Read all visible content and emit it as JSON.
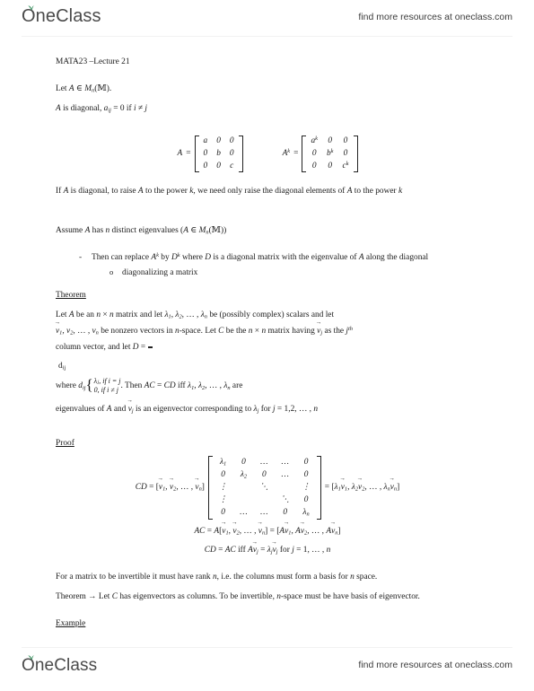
{
  "brand": {
    "name": "OneClass",
    "leaf_color": "#2e8b57",
    "text_color": "#4a4a4a",
    "tagline": "find more resources at oneclass.com"
  },
  "document": {
    "course_title": "MATA23 –Lecture 21",
    "line_let_a": "Let A ∈ Mₙ(ℝ).",
    "line_diagonal": "A is diagonal, aᵢⱼ = 0 if i ≠ j",
    "matrix_a": {
      "label": "A",
      "rows": [
        [
          "a",
          "0",
          "0"
        ],
        [
          "0",
          "b",
          "0"
        ],
        [
          "0",
          "0",
          "c"
        ]
      ]
    },
    "matrix_ak": {
      "label": "Aᵏ",
      "rows": [
        [
          "aᵏ",
          "0",
          "0"
        ],
        [
          "0",
          "bᵏ",
          "0"
        ],
        [
          "0",
          "0",
          "cᵏ"
        ]
      ]
    },
    "para_power": "If A is diagonal, to raise A to the power k, we need only raise the diagonal elements of  A to the power k",
    "assume_line": "Assume A has n distinct eigenvalues (A ∈ Mₙ(ℝ))",
    "bullet_replace": "Then can replace Aᵏ by Dᵏ where D is a diagonal matrix with the eigenvalue of A along the diagonal",
    "bullet_diagonalizing": "diagonalizing a matrix",
    "theorem_heading": "Theorem",
    "theorem_line_1": "Let A be an n × n matrix and let λ₁, λ₂, … , λₙ be (possibly complex) scalars and let",
    "theorem_line_2": "v⃗₁, v₂, … , vₙ be nonzero vectors in n-space. Let C be the n × n matrix having v⃗ⱼ as the jᵗʰ",
    "theorem_line_3_a": "column vector, and let D = [dᵢⱼ] where dᵢⱼ",
    "theorem_cases_1": "λⱼ, if i = j",
    "theorem_cases_2": "0, if i ≠ j",
    "theorem_line_3_b": ". Then AC = CD iff λ₁, λ₂, … , λₙ are",
    "theorem_line_4": "eigenvalues of A and v⃗ⱼ is an eigenvector corresponding to λⱼ for j = 1,2, … , n",
    "proof_heading": "Proof",
    "proof_eq1_lhs": "CD = [v⃗₁, v⃗₂, … , v⃗ₙ]",
    "proof_matrix_d": {
      "rows": [
        [
          "λ₁",
          "0",
          "…",
          "…",
          "0"
        ],
        [
          "0",
          "λ₂",
          "0",
          "…",
          "0"
        ],
        [
          "⋮",
          "",
          "⋱",
          "",
          "⋮"
        ],
        [
          "⋮",
          "",
          "",
          "⋱",
          "0"
        ],
        [
          "0",
          "…",
          "…",
          "0",
          "λₙ"
        ]
      ]
    },
    "proof_eq1_rhs": "= [λ₁v⃗₁, λ₂v⃗₂, … , λₙv⃗ₙ]",
    "proof_eq2": "AC = A[v⃗₁, v⃗₂, … , v⃗ₙ] = [Av⃗₁, Av⃗₂, … , Av⃗ₙ]",
    "proof_eq3": "CD = AC iff Av⃗ⱼ = λⱼv⃗ⱼ for j = 1, … , n",
    "para_invertible": "For a matrix to be invertible it must have rank n, i.e. the columns must form a basis for n space.",
    "para_theorem_arrow": "Theorem → Let C has eigenvectors as columns. To be invertible, n-space must be have basis of eigenvector.",
    "example_heading": "Example"
  }
}
